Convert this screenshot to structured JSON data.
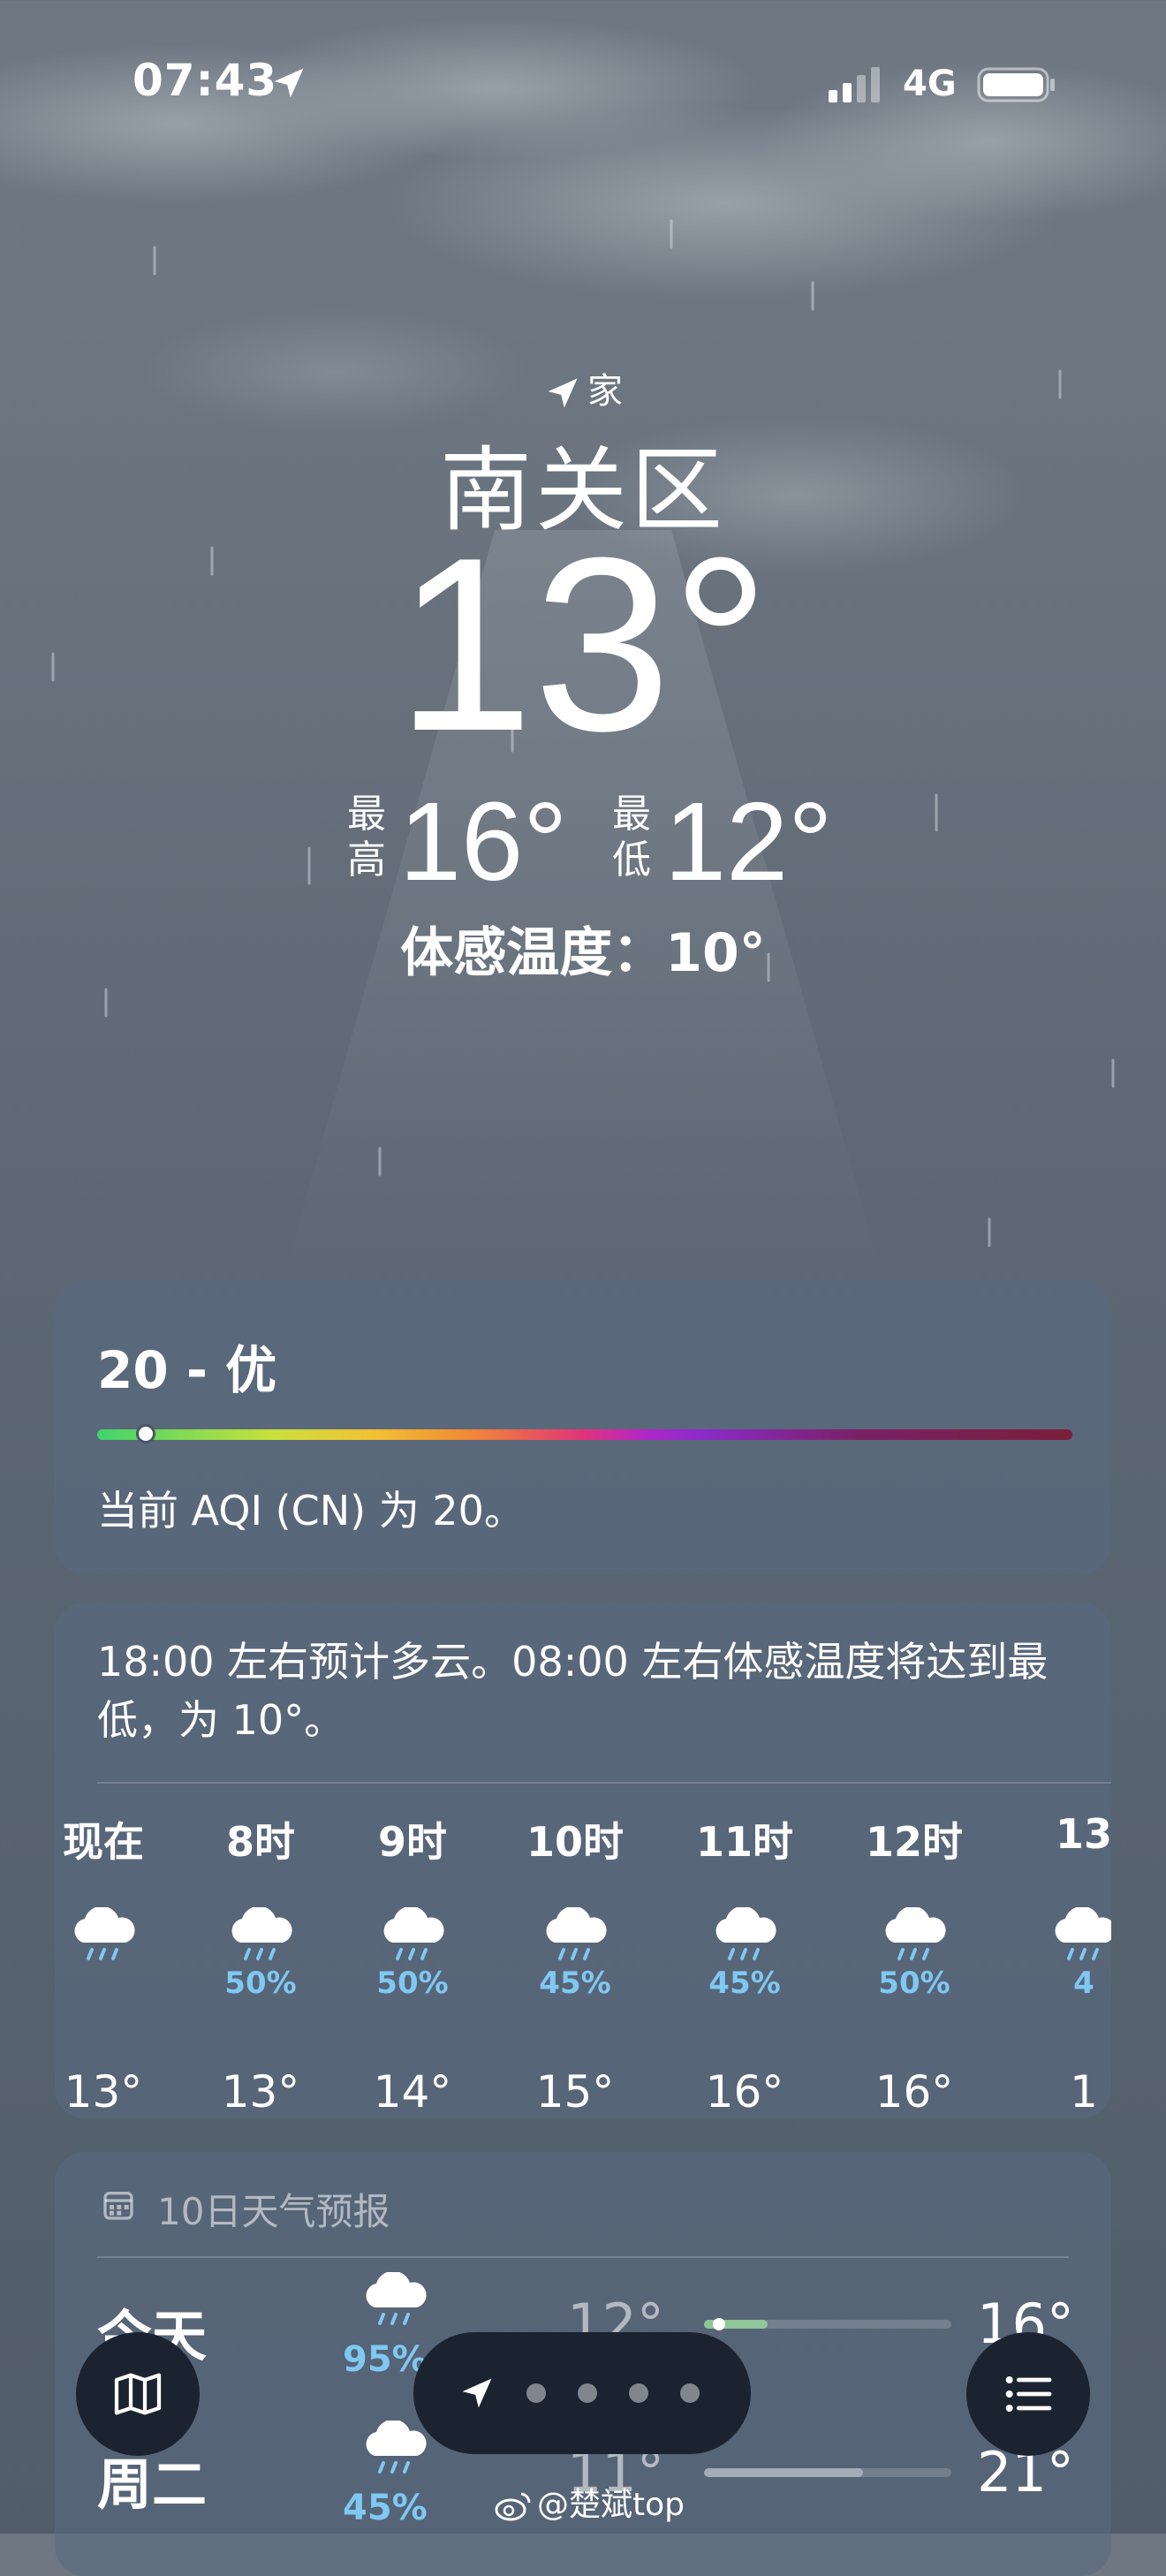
{
  "status_bar": {
    "time": "07:43",
    "network": "4G"
  },
  "location": {
    "label": "家",
    "city": "南关区"
  },
  "current": {
    "temperature": "13°",
    "high_label": "最高",
    "high": "16°",
    "low_label": "最低",
    "low": "12°",
    "feels_like": "体感温度：10°"
  },
  "aqi": {
    "title": "20 - 优",
    "value": 20,
    "description": "当前 AQI (CN) 为 20。"
  },
  "hourly": {
    "summary": "18:00 左右预计多云。08:00 左右体感温度将达到最低，为 10°。",
    "hours": [
      {
        "label": "现在",
        "icon": "rain-cloud-icon",
        "precip": "",
        "temp": "13°"
      },
      {
        "label": "8时",
        "icon": "rain-cloud-icon",
        "precip": "50%",
        "temp": "13°"
      },
      {
        "label": "9时",
        "icon": "rain-cloud-icon",
        "precip": "50%",
        "temp": "14°"
      },
      {
        "label": "10时",
        "icon": "rain-cloud-icon",
        "precip": "45%",
        "temp": "15°"
      },
      {
        "label": "11时",
        "icon": "rain-cloud-icon",
        "precip": "45%",
        "temp": "16°"
      },
      {
        "label": "12时",
        "icon": "rain-cloud-icon",
        "precip": "50%",
        "temp": "16°"
      },
      {
        "label": "13",
        "icon": "rain-cloud-icon",
        "precip": "4",
        "temp": "1"
      }
    ]
  },
  "daily": {
    "header": "10日天气预报",
    "days": [
      {
        "day": "今天",
        "icon": "rain-cloud-icon",
        "precip": "95%",
        "low": "12°",
        "high": "16°"
      },
      {
        "day": "周二",
        "icon": "rain-cloud-icon",
        "precip": "45%",
        "low": "11°",
        "high": "21°"
      }
    ]
  },
  "toolbar": {
    "page_dots": 4
  },
  "watermark": "@楚斌top",
  "colors": {
    "precip": "#7fc8f2",
    "aqi_good": "#3fd46b"
  }
}
